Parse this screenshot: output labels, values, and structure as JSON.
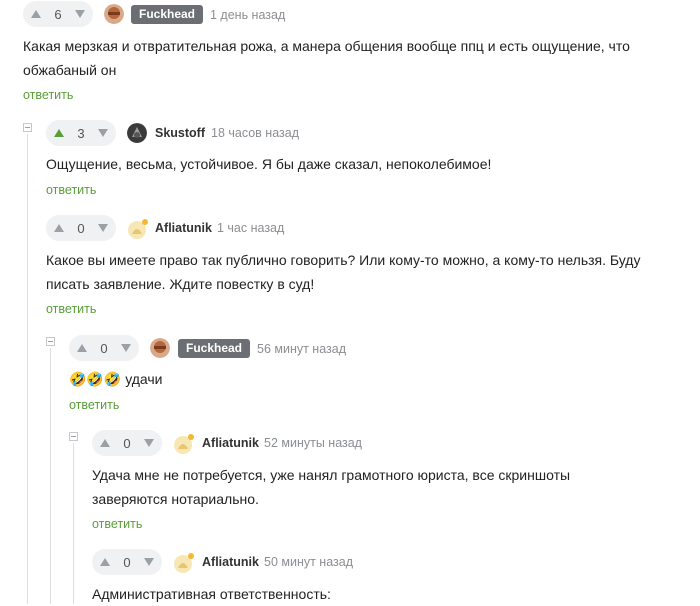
{
  "comments": [
    {
      "id": "c1",
      "rating": "6",
      "rating_color": "#9aa0a6",
      "author": "Fuckhead",
      "time": "1 день назад",
      "text_lines": [
        "Какая мерзкая и отвратительная рожа, а манера общения вообще ппц и есть ощущение, что",
        "обжабаный он"
      ],
      "reply_label": "ответить"
    },
    {
      "id": "c2",
      "rating": "3",
      "rating_color": "#5a9e3a",
      "author": "Skustoff",
      "time": "18 часов назад",
      "text_lines": [
        "Ощущение, весьма, устойчивое. Я бы даже сказал, непоколебимое!"
      ],
      "reply_label": "ответить"
    },
    {
      "id": "c3",
      "rating": "0",
      "author": "Afliatunik",
      "time": "1 час назад",
      "text_lines": [
        "Какое вы имеете право так публично говорить? Или кому-то можно, а кому-то нельзя. Буду",
        "писать заявление. Ждите повестку в суд!"
      ],
      "reply_label": "ответить"
    },
    {
      "id": "c4",
      "rating": "0",
      "author": "Fuckhead",
      "time": "56 минут назад",
      "text_lines": [
        "удачи"
      ],
      "emoji": "🤣🤣🤣",
      "reply_label": "ответить"
    },
    {
      "id": "c5",
      "rating": "0",
      "author": "Afliatunik",
      "time": "52 минуты назад",
      "text_lines": [
        "Удача мне не потребуется, уже нанял грамотного юриста, все скриншоты",
        "заверяются нотариально."
      ],
      "reply_label": "ответить"
    },
    {
      "id": "c6",
      "rating": "0",
      "author": "Afliatunik",
      "time": "50 минут назад",
      "text_lines": [
        "Административная ответственность:"
      ]
    }
  ],
  "colors": {
    "accent_green": "#5a9e3a",
    "badge_gray": "#6b6e72",
    "thread_line": "#dcdee1"
  }
}
